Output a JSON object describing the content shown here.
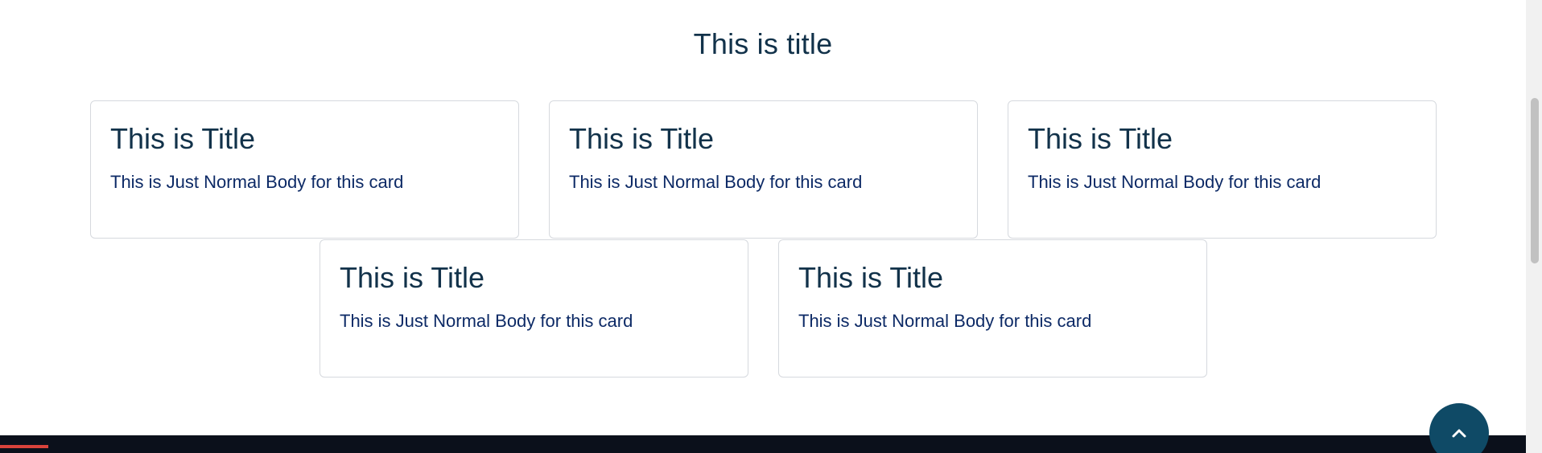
{
  "section": {
    "title": "This is title"
  },
  "cards": [
    {
      "title": "This is Title",
      "body": "This is Just Normal Body for this card"
    },
    {
      "title": "This is Title",
      "body": "This is Just Normal Body for this card"
    },
    {
      "title": "This is Title",
      "body": "This is Just Normal Body for this card"
    },
    {
      "title": "This is Title",
      "body": "This is Just Normal Body for this card"
    },
    {
      "title": "This is Title",
      "body": "This is Just Normal Body for this card"
    }
  ],
  "scroll_top": {
    "icon": "chevron-up-icon",
    "color": "#0f4a66"
  },
  "colors": {
    "heading": "#12324a",
    "body_text": "#0d2a66",
    "card_border": "#d6d9de",
    "footer": "#0b101b",
    "footer_accent": "#d9433b"
  }
}
